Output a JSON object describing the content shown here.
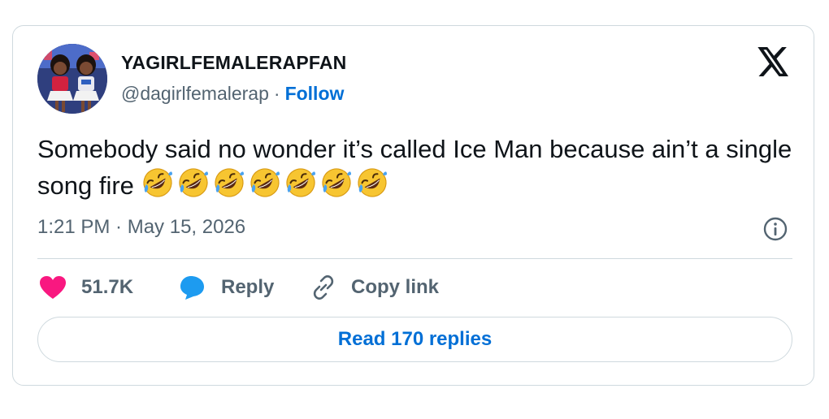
{
  "author": {
    "display_name": "YAGIRLFEMALERAPFAN",
    "handle": "@dagirlfemalerap",
    "separator": "·",
    "follow_label": "Follow"
  },
  "tweet": {
    "text": "Somebody said no wonder it’s called Ice Man because ain’t a single song fire",
    "emoji": "rolling-on-floor-laughing",
    "emoji_count": 7,
    "timestamp": "1:21 PM · May 15, 2026"
  },
  "actions": {
    "like_count": "51.7K",
    "reply_label": "Reply",
    "copy_link_label": "Copy link"
  },
  "read_replies_label": "Read 170 replies",
  "colors": {
    "link": "#006fd6",
    "like": "#f91880",
    "reply": "#1d9bf0",
    "secondary_text": "#536471",
    "border": "#cfd9de"
  },
  "icons": [
    "x-logo-icon",
    "info-icon",
    "heart-icon",
    "reply-bubble-icon",
    "link-icon"
  ]
}
